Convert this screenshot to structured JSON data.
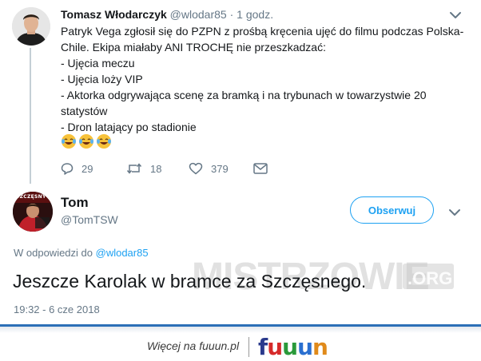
{
  "parent_tweet": {
    "name": "Tomasz Włodarczyk",
    "handle": "@wlodar85",
    "dot": "·",
    "time": "1 godz.",
    "lines": [
      "Patryk Vega zgłosił się do PZPN z prośbą kręcenia ujęć do filmu podczas Polska-",
      "Chile. Ekipa miałaby ANI TROCHĘ nie przeszkadzać:",
      "- Ujęcia meczu",
      "- Ujęcia loży VIP",
      "- Aktorka odgrywająca scenę za bramką i na trybunach w towarzystwie 20",
      "statystów",
      "- Dron latający po stadionie"
    ],
    "emojis": [
      "face-with-tears-of-joy",
      "face-with-tears-of-joy",
      "face-with-tears-of-joy"
    ],
    "actions": {
      "reply_count": "29",
      "retweet_count": "18",
      "like_count": "379"
    }
  },
  "reply_tweet": {
    "name": "Tom",
    "handle": "@TomTSW",
    "follow_label": "Obserwuj",
    "reply_prefix": "W odpowiedzi do",
    "reply_mention": "@wlodar85",
    "text": "Jeszcze Karolak w bramce za Szczęsnego.",
    "timestamp": "19:32 - 6 cze 2018",
    "avatar_caption": "SZCZĘSNY"
  },
  "watermark": {
    "text": "MISTRZOWIE",
    "suffix": ".ORG"
  },
  "footer": {
    "link_text": "Więcej na fuuun.pl",
    "logo_letters": [
      "f",
      "u",
      "u",
      "u",
      "n"
    ],
    "logo_colors": [
      "#2a3a8c",
      "#d62a2a",
      "#2a9a3a",
      "#2a6fd0",
      "#e08a1a"
    ]
  },
  "colors": {
    "twitter_blue": "#1da1f2",
    "secondary_text": "#657786",
    "thread_line": "#c4cfd6",
    "footer_bar": "#2c6fb7"
  }
}
